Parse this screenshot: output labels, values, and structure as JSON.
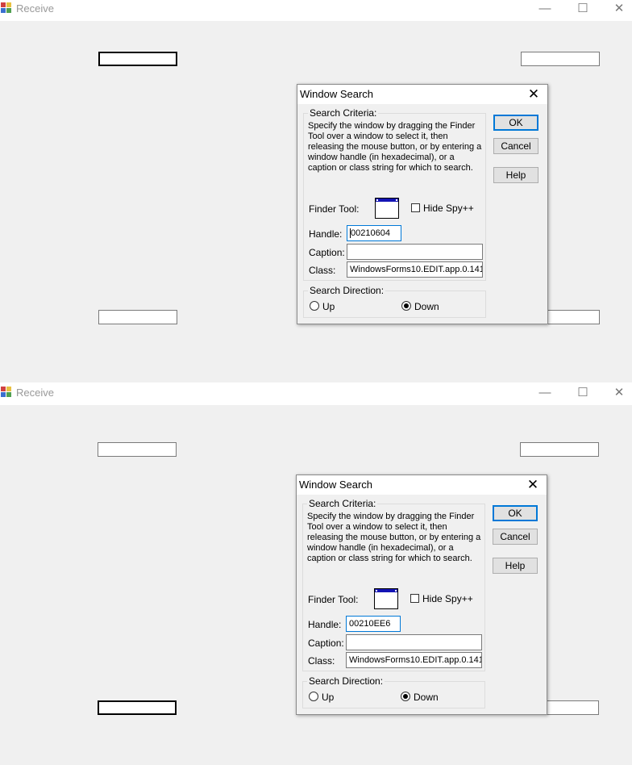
{
  "colors": {
    "accent": "#0078d7",
    "finder_bar": "#1414b4",
    "background": "#f0f0f0"
  },
  "windows": [
    {
      "title": "Receive",
      "controls": {
        "minimize": "—",
        "maximize": "☐",
        "close": "✕"
      },
      "dialog": {
        "title": "Window Search",
        "close": "✕",
        "criteria_legend": "Search Criteria:",
        "instructions": "Specify the window by dragging the Finder Tool over a window to select it, then releasing the mouse button, or by entering a window handle (in hexadecimal), or a caption or class string for which to search.",
        "finder_label": "Finder Tool:",
        "hide_spy_label": "Hide Spy++",
        "hide_spy_checked": false,
        "handle_label": "Handle:",
        "handle_value": "00210604",
        "caption_label": "Caption:",
        "caption_value": "",
        "class_label": "Class:",
        "class_value": "WindowsForms10.EDIT.app.0.141",
        "direction_legend": "Search Direction:",
        "up_label": "Up",
        "down_label": "Down",
        "direction_selected": "Down",
        "ok_label": "OK",
        "cancel_label": "Cancel",
        "help_label": "Help"
      }
    },
    {
      "title": "Receive",
      "controls": {
        "minimize": "—",
        "maximize": "☐",
        "close": "✕"
      },
      "dialog": {
        "title": "Window Search",
        "close": "✕",
        "criteria_legend": "Search Criteria:",
        "instructions": "Specify the window by dragging the Finder Tool over a window to select it, then releasing the mouse button, or by entering a window handle (in hexadecimal), or a caption or class string for which to search.",
        "finder_label": "Finder Tool:",
        "hide_spy_label": "Hide Spy++",
        "hide_spy_checked": false,
        "handle_label": "Handle:",
        "handle_value": "00210EE6",
        "caption_label": "Caption:",
        "caption_value": "",
        "class_label": "Class:",
        "class_value": "WindowsForms10.EDIT.app.0.141",
        "direction_legend": "Search Direction:",
        "up_label": "Up",
        "down_label": "Down",
        "direction_selected": "Down",
        "ok_label": "OK",
        "cancel_label": "Cancel",
        "help_label": "Help"
      }
    }
  ]
}
